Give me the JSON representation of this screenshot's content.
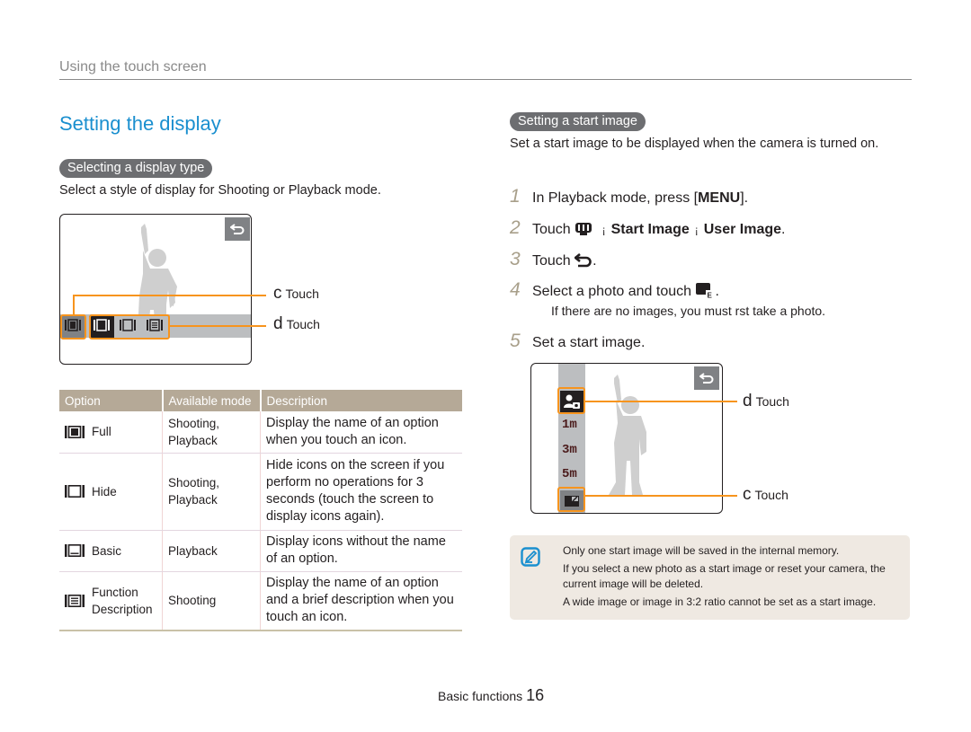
{
  "header": {
    "section": "Using the touch screen"
  },
  "page": {
    "title": "Setting the display"
  },
  "display_type": {
    "pill": "Selecting a display type",
    "intro": "Select a style of display for Shooting or Playback mode.",
    "callouts": [
      {
        "letter": "c",
        "text": "Touch"
      },
      {
        "letter": "d",
        "text": "Touch"
      }
    ],
    "table": {
      "headers": [
        "Option",
        "Available mode",
        "Description"
      ],
      "rows": [
        {
          "icon": "display-full-icon",
          "option": "Full",
          "mode": "Shooting, Playback",
          "description": "Display the name of an option when you touch an icon."
        },
        {
          "icon": "display-hide-icon",
          "option": "Hide",
          "mode": "Shooting, Playback",
          "description": "Hide icons on the screen if you perform no operations for 3 seconds (touch the screen to display icons again)."
        },
        {
          "icon": "display-basic-icon",
          "option": "Basic",
          "mode": "Playback",
          "description": "Display icons without the name of an option."
        },
        {
          "icon": "display-function-description-icon",
          "option": "Function Description",
          "mode": "Shooting",
          "description": "Display the name of an option and a brief description when you touch an icon."
        }
      ]
    }
  },
  "start_image": {
    "pill": "Setting a start image",
    "intro": "Set a start image to be displayed when the camera is turned on.",
    "steps": [
      {
        "num": "1",
        "pre": "In Playback mode, press [",
        "bold": "MENU",
        "post": "]."
      },
      {
        "num": "2",
        "pre": "Touch",
        "sep": "¡",
        "bold1": "Start Image",
        "bold2": "User Image",
        "post": "."
      },
      {
        "num": "3",
        "pre": "Touch",
        "post": "."
      },
      {
        "num": "4",
        "pre": "Select a photo and touch",
        "post": ".",
        "note": "If there are no images, you must  rst take a photo."
      },
      {
        "num": "5",
        "pre": "Set a start image."
      }
    ],
    "menu_items": [
      "1m",
      "3m",
      "5m"
    ],
    "callouts": [
      {
        "letter": "d",
        "text": "Touch"
      },
      {
        "letter": "c",
        "text": "Touch"
      }
    ],
    "notes": [
      "Only one start image will be saved in the internal memory.",
      "If you select a new photo as a start image or reset your camera, the current image will be deleted.",
      "A wide image or image in 3:2 ratio cannot be set as a start image."
    ]
  },
  "footer": {
    "label": "Basic functions",
    "page_number": "16"
  },
  "colors": {
    "accent_blue": "#1a8fcf",
    "callout_orange": "#f7941d",
    "table_header": "#b5a997",
    "note_bg": "#efe9e2",
    "pill_bg": "#6d6e71"
  }
}
